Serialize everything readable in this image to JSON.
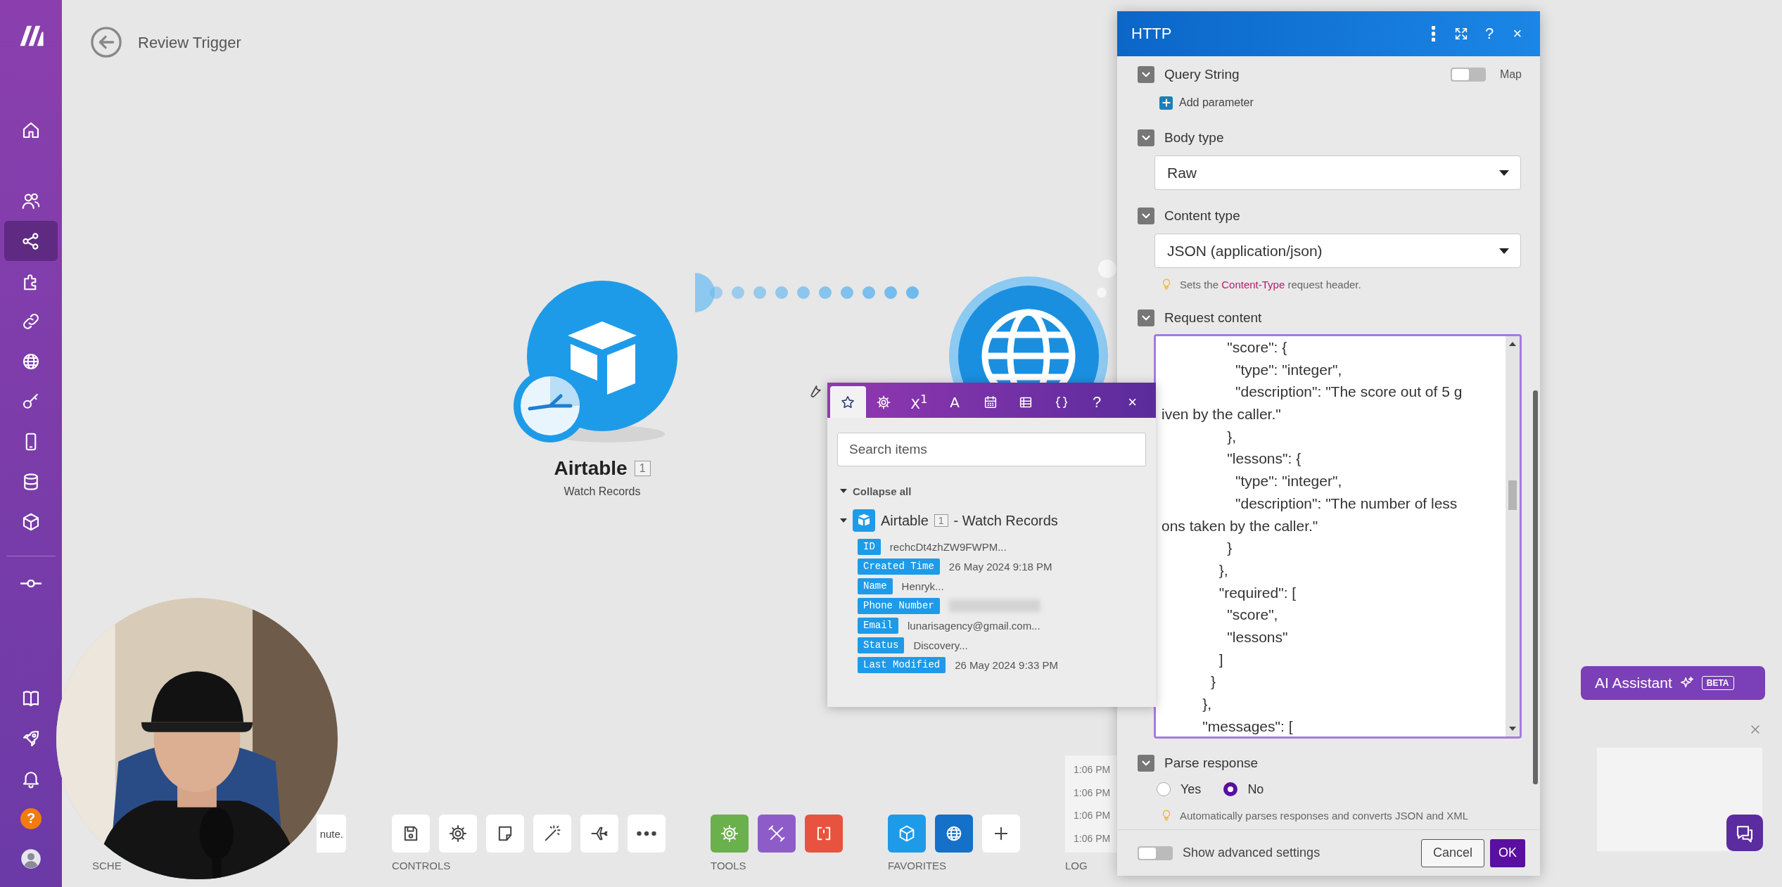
{
  "sidebar": {
    "items": [
      {
        "kind": "home",
        "selected": false
      },
      {
        "kind": "users",
        "selected": false
      },
      {
        "kind": "share",
        "selected": true
      },
      {
        "kind": "puzzle",
        "selected": false
      },
      {
        "kind": "link",
        "selected": false
      },
      {
        "kind": "globe",
        "selected": false
      },
      {
        "kind": "key",
        "selected": false
      },
      {
        "kind": "phone",
        "selected": false
      },
      {
        "kind": "database",
        "selected": false
      },
      {
        "kind": "cube",
        "selected": false
      },
      {
        "kind": "commit",
        "selected": false
      }
    ],
    "bottom_items": [
      {
        "kind": "book",
        "selected": false
      },
      {
        "kind": "rocket",
        "selected": false
      },
      {
        "kind": "bell",
        "selected": false
      },
      {
        "kind": "help",
        "label": "?",
        "selected": false
      },
      {
        "kind": "avatar",
        "selected": false
      }
    ]
  },
  "header": {
    "title": "Review Trigger"
  },
  "trigger_module": {
    "name": "Airtable",
    "number": "1",
    "subtitle": "Watch Records"
  },
  "mapping_panel": {
    "tabs": [
      {
        "kind": "star",
        "selected": true
      },
      {
        "kind": "gear",
        "selected": false
      },
      {
        "kind": "text",
        "label": "X$^{1}$",
        "selected": false
      },
      {
        "kind": "text",
        "label": "A",
        "selected": false
      },
      {
        "kind": "calendar",
        "selected": false
      },
      {
        "kind": "table",
        "selected": false
      },
      {
        "kind": "braces",
        "selected": false
      }
    ],
    "help": "?",
    "close": "×",
    "search": {
      "placeholder": "Search items"
    },
    "collapse_label": "Collapse all",
    "source": {
      "name": "Airtable",
      "number": "1",
      "suffix": "- Watch Records",
      "expanded": true
    },
    "items": [
      {
        "kind": "text",
        "label": "ID",
        "value": "rechcDt4zhZW9FWPM..."
      },
      {
        "kind": "text",
        "label": "Created Time",
        "value": "26 May 2024 9:18 PM"
      },
      {
        "kind": "text",
        "label": "Name",
        "value": "Henryk..."
      },
      {
        "kind": "blurred",
        "label": "Phone Number"
      },
      {
        "kind": "text",
        "label": "Email",
        "value": "lunarisagency@gmail.com..."
      },
      {
        "kind": "text",
        "label": "Status",
        "value": "Discovery..."
      },
      {
        "kind": "text",
        "label": "Last Modified",
        "value": "26 May 2024 9:33 PM"
      }
    ]
  },
  "http_panel": {
    "title": "HTTP",
    "header_buttons": [
      {
        "kind": "menu"
      },
      {
        "kind": "expand"
      },
      {
        "kind": "help",
        "label": "?"
      },
      {
        "kind": "close",
        "label": "×"
      }
    ],
    "query_string": {
      "label": "Query String",
      "expanded": true,
      "map_label": "Map",
      "map_on": false,
      "add_label": "Add parameter"
    },
    "body_type": {
      "label": "Body type",
      "expanded": true,
      "value": "Raw"
    },
    "content_type": {
      "label": "Content type",
      "expanded": true,
      "value": "JSON (application/json)",
      "hint_parts": [
        {
          "kind": "plain",
          "text": "Sets the "
        },
        {
          "kind": "code",
          "text": "Content-Type"
        },
        {
          "kind": "plain",
          "text": " request header."
        }
      ]
    },
    "request_content": {
      "label": "Request content",
      "expanded": true,
      "lines": [
        "                \"score\": {",
        "                  \"type\": \"integer\",",
        "                  \"description\": \"The score out of 5 g",
        "iven by the caller.\"",
        "                },",
        "                \"lessons\": {",
        "                  \"type\": \"integer\",",
        "                  \"description\": \"The number of less",
        "ons taken by the caller.\"",
        "                }",
        "              },",
        "              \"required\": [",
        "                \"score\",",
        "                \"lessons\"",
        "              ]",
        "            }",
        "          },",
        "          \"messages\": ["
      ]
    },
    "parse_response": {
      "label": "Parse response",
      "expanded": true,
      "options": [
        {
          "label": "Yes",
          "selected": false
        },
        {
          "label": "No",
          "selected": true
        }
      ],
      "hint": "Automatically parses responses and converts JSON and XML"
    },
    "footer": {
      "advanced_label": "Show advanced settings",
      "advanced_on": false,
      "cancel": "Cancel",
      "ok": "OK"
    }
  },
  "toolbar": {
    "schedule": {
      "label": "SCHE",
      "button": "nute."
    },
    "controls": {
      "label": "CONTROLS",
      "buttons": [
        {
          "kind": "save"
        },
        {
          "kind": "gear"
        },
        {
          "kind": "note"
        },
        {
          "kind": "wand"
        },
        {
          "kind": "plane"
        },
        {
          "kind": "dots"
        }
      ]
    },
    "tools": {
      "label": "TOOLS",
      "buttons": [
        {
          "kind": "gear",
          "color": "#6ab04c"
        },
        {
          "kind": "tools",
          "color": "#8e5cc9"
        },
        {
          "kind": "brackets",
          "color": "#e8533f"
        }
      ]
    },
    "favorites": {
      "label": "FAVORITES",
      "buttons": [
        {
          "kind": "cube",
          "color": "#1e9be8"
        },
        {
          "kind": "globe",
          "color": "#1470c8"
        },
        {
          "kind": "plus",
          "color": "#ffffff"
        }
      ]
    },
    "log": {
      "label": "LOG",
      "entries": [
        "1:06 PM",
        "1:06 PM",
        "1:06 PM",
        "1:06 PM"
      ]
    }
  },
  "ai_assistant": {
    "label": "AI Assistant",
    "badge": "BETA"
  }
}
